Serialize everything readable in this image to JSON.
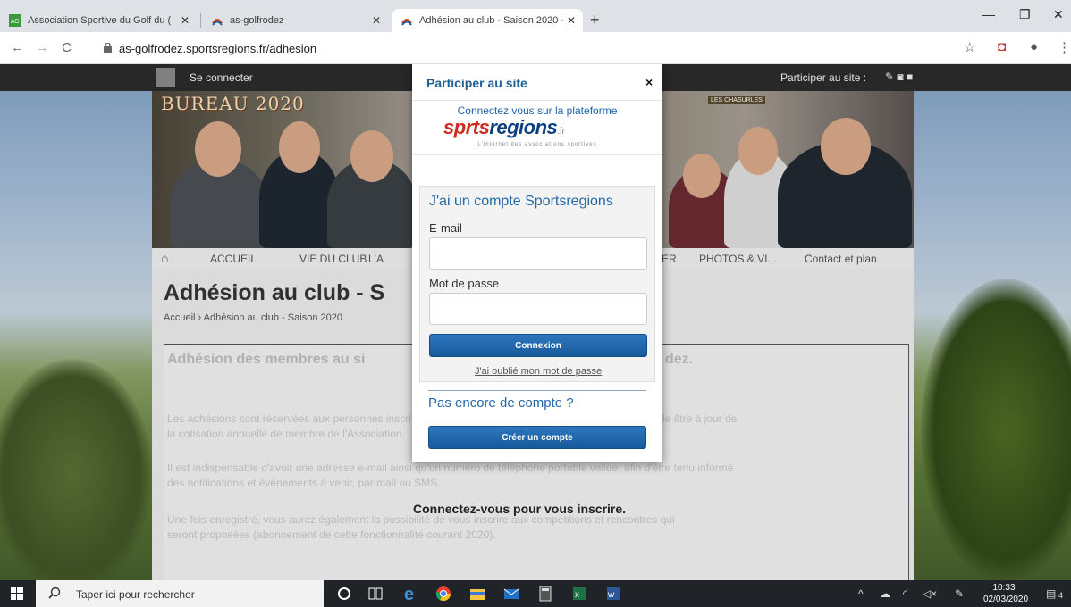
{
  "browser": {
    "tabs": [
      {
        "title": "Association Sportive du Golf du (",
        "active": false
      },
      {
        "title": "as-golfrodez",
        "active": false
      },
      {
        "title": "Adhésion au club - Saison 2020 -",
        "active": true
      }
    ],
    "new_tab_icon": "plus-icon",
    "url": "as-golfrodez.sportsregions.fr/adhesion"
  },
  "site": {
    "login_label": "Se connecter",
    "participate_label": "Participer au site :",
    "banner_logo": "BUREAU 2020",
    "banner_sign": "LES CHASURLES",
    "nav": [
      "ACCUEIL",
      "VIE DU CLUB",
      "L'A",
      "ER",
      "PHOTOS & VI...",
      "Contact et plan"
    ],
    "page_title": "Adhésion au club - S",
    "breadcrumb": "Accueil › Adhésion au club - Saison 2020",
    "content": {
      "heading_left": "Adhésion des membres au si",
      "heading_right": "dez.",
      "paragraphs": [
        "Les adhésions sont réservées aux personnes inscrites à l'Association Sportive du Golf. Il faut au préalable être à jour de",
        "la cotisation annuelle de membre de l'Association.",
        "Il est indispensable d'avoir une adresse e-mail ainsi qu'un numéro de téléphone portable valide, afin d'être tenu informé",
        "des notifications et évènements à venir, par mail ou SMS.",
        "Une fois enregistré, vous aurez également la possibilité de vous inscrire aux compétitions et rencontres qui",
        "seront proposées (abonnement de cette fonctionnalité courant 2020)."
      ],
      "cta": "Connectez-vous pour vous inscrire."
    }
  },
  "modal": {
    "title": "Participer au site",
    "close": "×",
    "platform_text": "Connectez vous sur la plateforme",
    "brand": {
      "part1": "sp",
      "part2": "rts",
      "part3": "regions",
      "suffix": ".fr"
    },
    "tagline": "L'internet des associations sportives",
    "account_title": "J'ai un compte Sportsregions",
    "email_label": "E-mail",
    "password_label": "Mot de passe",
    "email_value": "",
    "password_value": "",
    "login_button": "Connexion",
    "forgot_link": "J'ai oublié mon mot de passe",
    "no_account": "Pas encore de compte ?",
    "create_button": "Créer un compte"
  },
  "taskbar": {
    "search_placeholder": "Taper ici pour rechercher",
    "time": "10:33",
    "date": "02/03/2020",
    "notifications": "4",
    "apps": [
      "cortana-icon",
      "task-view-icon",
      "edge-icon",
      "chrome-icon",
      "file-explorer-icon",
      "mail-icon",
      "calculator-icon",
      "excel-icon",
      "word-icon"
    ]
  },
  "colors": {
    "accent": "#1f5f95",
    "button": "#1e64a8",
    "taskbar": "#202327"
  }
}
